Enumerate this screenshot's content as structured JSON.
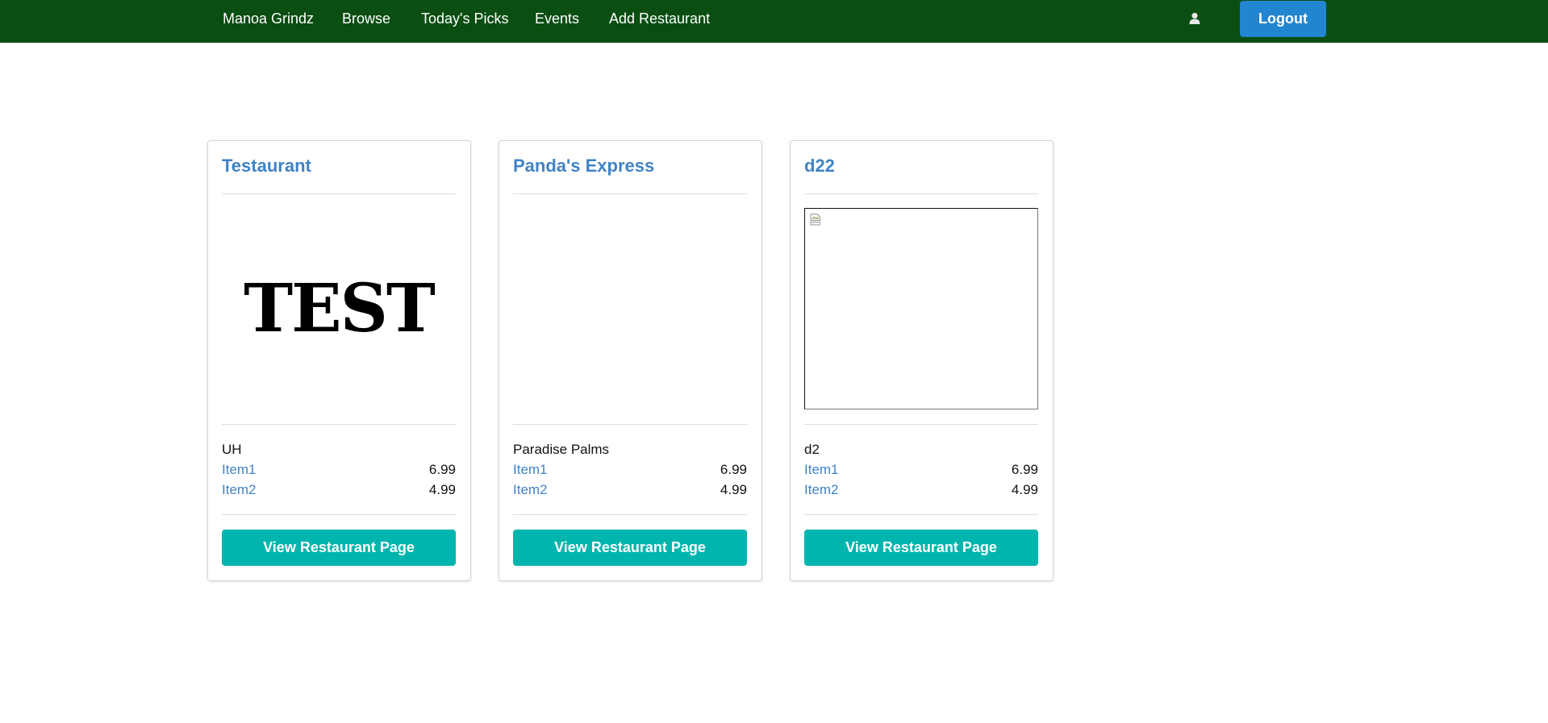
{
  "navbar": {
    "brand": "Manoa Grindz",
    "links": [
      "Browse",
      "Today's Picks",
      "Events",
      "Add Restaurant"
    ],
    "user_icon": "user-icon",
    "logout_label": "Logout",
    "bg_color": "#0a4e12",
    "logout_color": "#2185d0"
  },
  "cards": [
    {
      "title": "Testaurant",
      "image_text": "TEST",
      "location": "UH",
      "menu": [
        {
          "name": "Item1",
          "price": "6.99"
        },
        {
          "name": "Item2",
          "price": "4.99"
        }
      ],
      "button_label": "View Restaurant Page"
    },
    {
      "title": "Panda's Express",
      "location": "Paradise Palms",
      "menu": [
        {
          "name": "Item1",
          "price": "6.99"
        },
        {
          "name": "Item2",
          "price": "4.99"
        }
      ],
      "button_label": "View Restaurant Page"
    },
    {
      "title": "d22",
      "image_icon": "broken-image-icon",
      "location": "d2",
      "menu": [
        {
          "name": "Item1",
          "price": "6.99"
        },
        {
          "name": "Item2",
          "price": "4.99"
        }
      ],
      "button_label": "View Restaurant Page"
    }
  ],
  "colors": {
    "link": "#4183c4",
    "button": "#00b5ad"
  }
}
